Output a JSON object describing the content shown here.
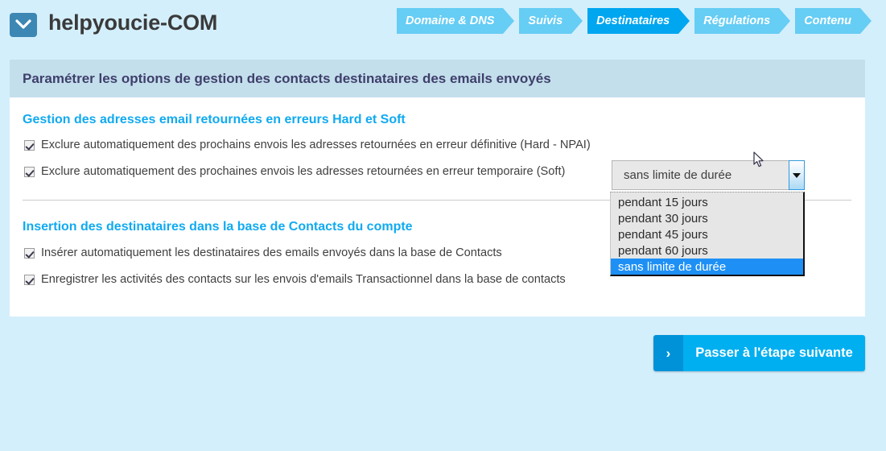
{
  "header": {
    "brand": "helpyoucie-COM",
    "logo_icon": "envelope-icon"
  },
  "steps": [
    {
      "label": "Domaine & DNS",
      "active": false
    },
    {
      "label": "Suivis",
      "active": false
    },
    {
      "label": "Destinataires",
      "active": true
    },
    {
      "label": "Régulations",
      "active": false
    },
    {
      "label": "Contenu",
      "active": false
    }
  ],
  "panel": {
    "title": "Paramétrer les options de gestion des contacts destinataires des emails envoyés"
  },
  "sections": [
    {
      "heading": "Gestion des adresses email retournées en erreurs Hard et Soft",
      "rows": [
        {
          "checked": true,
          "label": "Exclure automatiquement des prochains envois les adresses retournées en erreur définitive (Hard - NPAI)"
        },
        {
          "checked": true,
          "label": "Exclure automatiquement des prochaines envois les adresses retournées en erreur temporaire (Soft)"
        }
      ]
    },
    {
      "heading": "Insertion des destinataires dans la base de Contacts du compte",
      "rows": [
        {
          "checked": true,
          "label": "Insérer automatiquement les destinataires des emails envoyés dans la base de Contacts"
        },
        {
          "checked": true,
          "label": "Enregistrer les activités des contacts sur les envois d'emails Transactionnel dans la base de contacts"
        }
      ]
    }
  ],
  "soft_duration_select": {
    "value": "sans limite de durée",
    "expanded": true,
    "arrow_icon": "chevron-down-icon",
    "options": [
      {
        "label": "pendant 15 jours",
        "selected": false
      },
      {
        "label": "pendant 30 jours",
        "selected": false
      },
      {
        "label": "pendant 45 jours",
        "selected": false
      },
      {
        "label": "pendant 60 jours",
        "selected": false
      },
      {
        "label": "sans limite de durée",
        "selected": true
      }
    ]
  },
  "next_button": {
    "chevron": "›",
    "label": "Passer à l'étape suivante"
  },
  "colors": {
    "page_background": "#d4effc",
    "accent_blue": "#00a6f0",
    "step_inactive": "#66cdf4",
    "heading_blue": "#10aaf0",
    "panel_title_bg": "#c3dfec",
    "panel_title_text": "#3f3f6b",
    "button_blue": "#00aff0",
    "button_chevron_blue": "#0092d8",
    "option_highlight": "#1e90f5",
    "logo_blue": "#3d87b4"
  }
}
